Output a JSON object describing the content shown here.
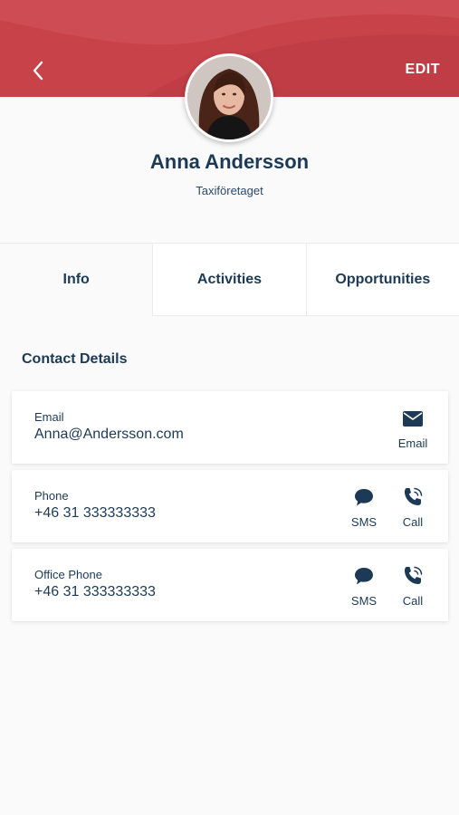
{
  "header": {
    "edit_label": "EDIT",
    "accent_color": "#c8424a"
  },
  "profile": {
    "name": "Anna Andersson",
    "company": "Taxiföretaget"
  },
  "tabs": [
    {
      "label": "Info",
      "active": true
    },
    {
      "label": "Activities",
      "active": false
    },
    {
      "label": "Opportunities",
      "active": false
    }
  ],
  "section_title": "Contact Details",
  "contacts": [
    {
      "label": "Email",
      "value": "Anna@Andersson.com",
      "actions": [
        {
          "icon": "envelope-icon",
          "label": "Email"
        }
      ]
    },
    {
      "label": "Phone",
      "value": "+46 31 333333333",
      "actions": [
        {
          "icon": "chat-bubble-icon",
          "label": "SMS"
        },
        {
          "icon": "phone-icon",
          "label": "Call"
        }
      ]
    },
    {
      "label": "Office Phone",
      "value": "+46 31 333333333",
      "actions": [
        {
          "icon": "chat-bubble-icon",
          "label": "SMS"
        },
        {
          "icon": "phone-icon",
          "label": "Call"
        }
      ]
    }
  ]
}
